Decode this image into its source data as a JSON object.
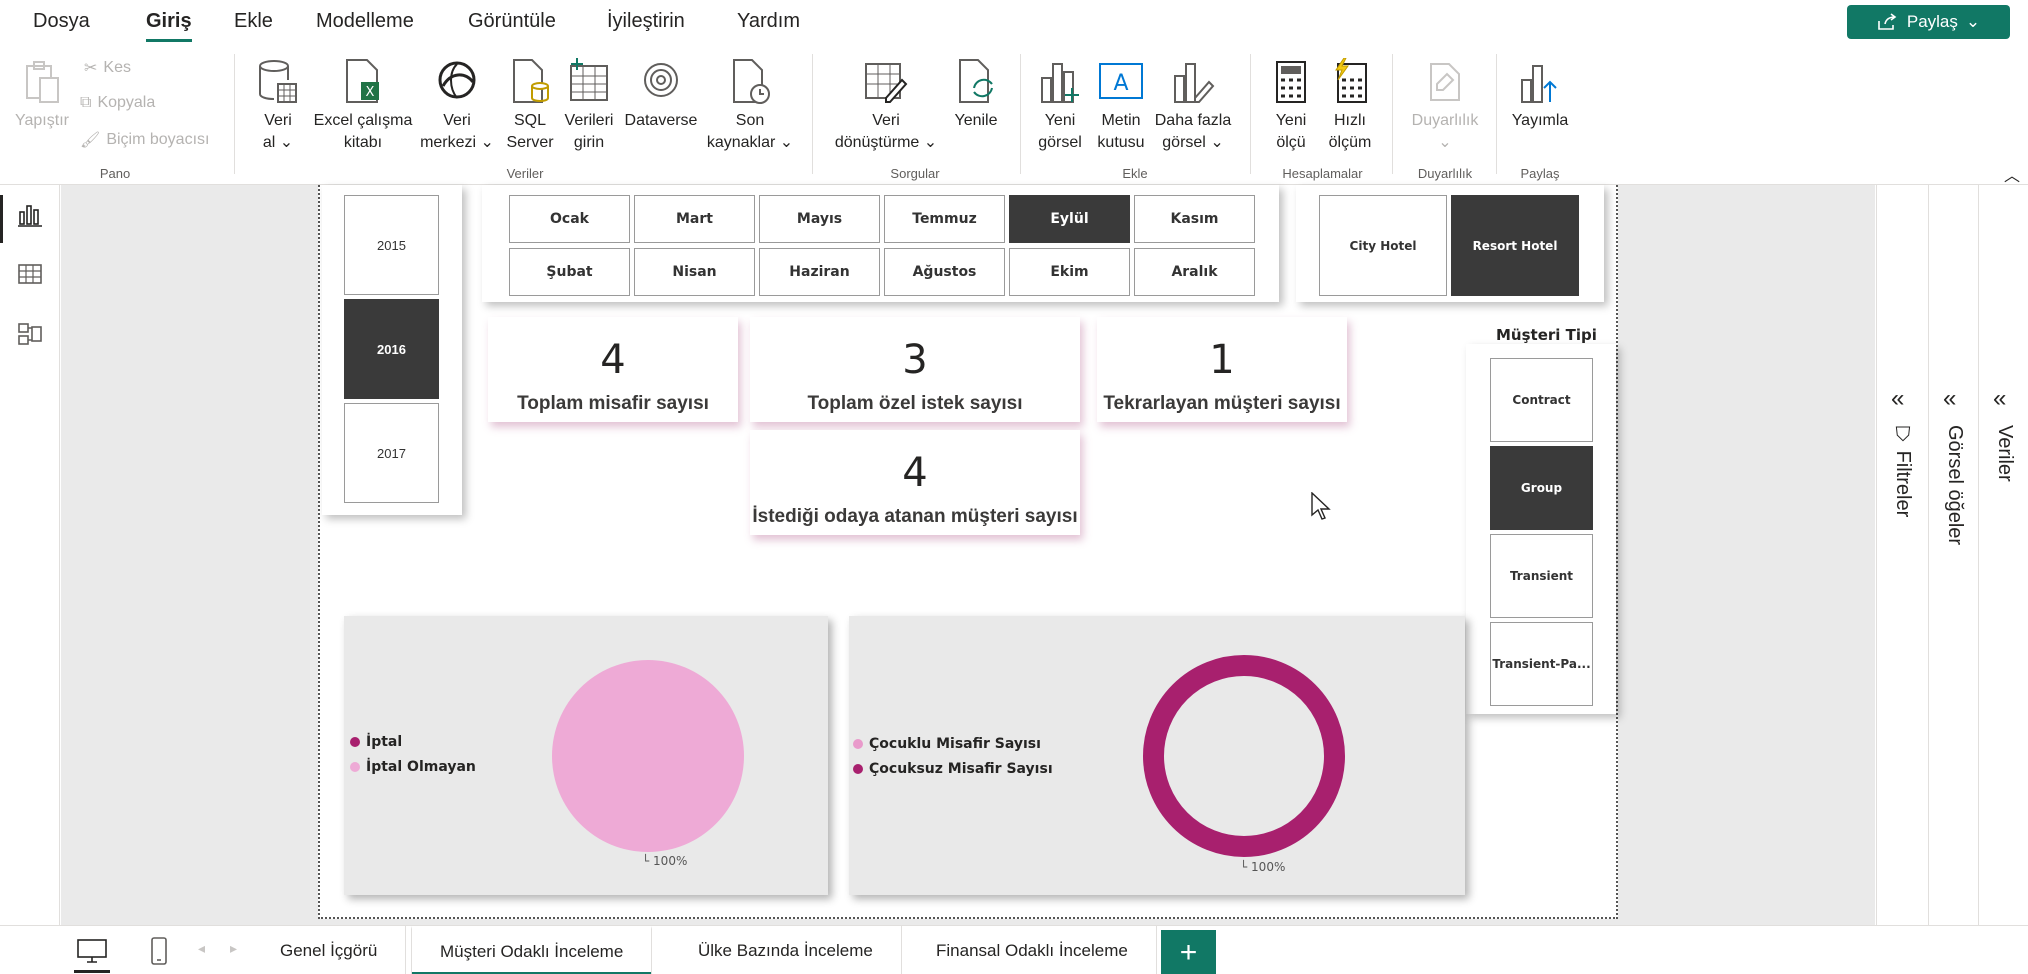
{
  "menu": {
    "items": [
      "Dosya",
      "Giriş",
      "Ekle",
      "Modelleme",
      "Görüntüle",
      "İyileştirin",
      "Yardım"
    ],
    "active": "Giriş",
    "share_label": "Paylaş"
  },
  "ribbon": {
    "paste": "Yapıştır",
    "cut": "Kes",
    "copy": "Kopyala",
    "format_painter": "Biçim boyacısı",
    "pano_label": "Pano",
    "get_data": [
      "Veri",
      "al"
    ],
    "excel": [
      "Excel çalışma",
      "kitabı"
    ],
    "data_hub": [
      "Veri",
      "merkezi"
    ],
    "sql": [
      "SQL",
      "Server"
    ],
    "enter_data": [
      "Verileri",
      "girin"
    ],
    "dataverse": "Dataverse",
    "recent": [
      "Son",
      "kaynaklar"
    ],
    "veriler_label": "Veriler",
    "transform": [
      "Veri",
      "dönüştürme"
    ],
    "refresh": "Yenile",
    "sorgular_label": "Sorgular",
    "new_visual": [
      "Yeni",
      "görsel"
    ],
    "text_box": [
      "Metin",
      "kutusu"
    ],
    "more_visuals": [
      "Daha fazla",
      "görsel"
    ],
    "ekle_label": "Ekle",
    "new_measure": [
      "Yeni",
      "ölçü"
    ],
    "quick_measure": [
      "Hızlı",
      "ölçüm"
    ],
    "hesaplamalar_label": "Hesaplamalar",
    "sensitivity": "Duyarlılık",
    "duyarlilik_label": "Duyarlılık",
    "publish": "Yayımla",
    "paylas_label": "Paylaş"
  },
  "report": {
    "years": [
      "2015",
      "2016",
      "2017"
    ],
    "selected_year": "2016",
    "months_row1": [
      "Ocak",
      "Mart",
      "Mayıs",
      "Temmuz",
      "Eylül",
      "Kasım"
    ],
    "months_row2": [
      "Şubat",
      "Nisan",
      "Haziran",
      "Ağustos",
      "Ekim",
      "Aralık"
    ],
    "selected_month": "Eylül",
    "hotels": [
      "City Hotel",
      "Resort Hotel"
    ],
    "selected_hotel": "Resort Hotel",
    "cards": [
      {
        "value": "4",
        "label": "Toplam misafir sayısı"
      },
      {
        "value": "3",
        "label": "Toplam özel istek sayısı"
      },
      {
        "value": "1",
        "label": "Tekrarlayan müşteri sayısı"
      },
      {
        "value": "4",
        "label": "İstediği odaya atanan müşteri sayısı"
      }
    ],
    "customer_type_title": "Müşteri Tipi",
    "customer_types": [
      "Contract",
      "Group",
      "Transient",
      "Transient-Pa..."
    ],
    "selected_customer_type": "Group"
  },
  "chart_data": [
    {
      "type": "pie",
      "categories": [
        "İptal",
        "İptal Olmayan"
      ],
      "values": [
        0,
        100
      ],
      "colors": [
        "#a8206e",
        "#eeaad6"
      ],
      "data_label": "100%"
    },
    {
      "type": "pie",
      "donut": true,
      "categories": [
        "Çocuklu Misafir Sayısı",
        "Çocuksuz Misafir Sayısı"
      ],
      "values": [
        0,
        100
      ],
      "colors": [
        "#e99acb",
        "#a8206e"
      ],
      "data_label": "100%"
    }
  ],
  "panes": {
    "filters": "Filtreler",
    "visuals": "Görsel öğeler",
    "data": "Veriler"
  },
  "tabs": {
    "pages": [
      "Genel İçgörü",
      "Müşteri Odaklı İnceleme",
      "Ülke Bazında İnceleme",
      "Finansal Odaklı İnceleme"
    ],
    "active": "Müşteri Odaklı İnceleme",
    "add_label": "+"
  }
}
